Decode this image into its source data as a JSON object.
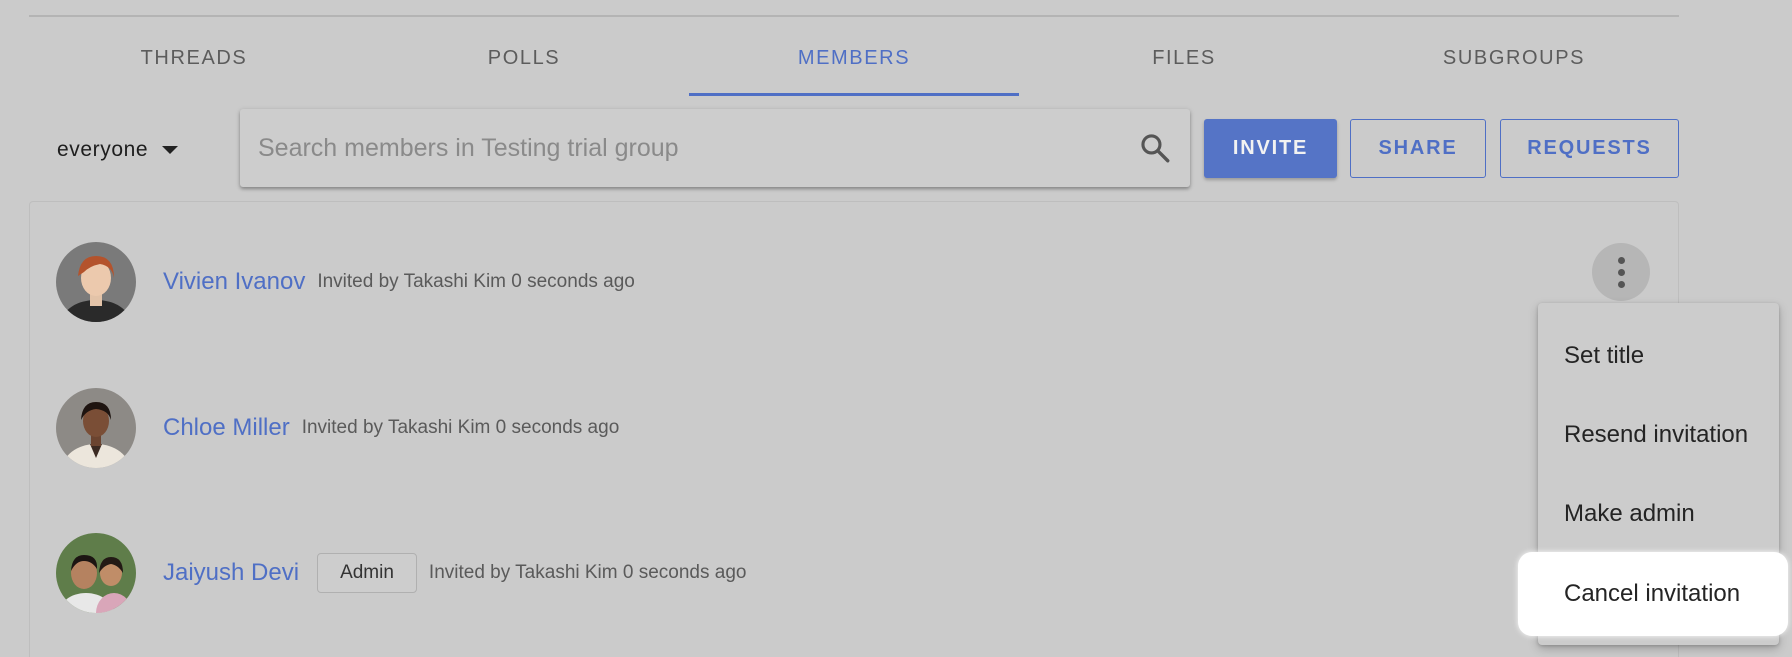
{
  "tabs": [
    "THREADS",
    "POLLS",
    "MEMBERS",
    "FILES",
    "SUBGROUPS"
  ],
  "active_tab": "MEMBERS",
  "filter": {
    "label": "everyone"
  },
  "search": {
    "placeholder": "Search members in Testing trial group",
    "value": ""
  },
  "actions": {
    "invite": "INVITE",
    "share": "SHARE",
    "requests": "REQUESTS"
  },
  "members": [
    {
      "name": "Vivien Ivanov",
      "invite_text": "Invited by Takashi Kim 0 seconds ago",
      "badge": ""
    },
    {
      "name": "Chloe Miller",
      "invite_text": "Invited by Takashi Kim 0 seconds ago",
      "badge": ""
    },
    {
      "name": "Jaiyush Devi",
      "invite_text": "Invited by Takashi Kim 0 seconds ago",
      "badge": "Admin"
    }
  ],
  "menu": {
    "items": [
      "Set title",
      "Resend invitation",
      "Make admin",
      "Cancel invitation"
    ],
    "highlighted": "Cancel invitation"
  },
  "colors": {
    "accent": "#4f6fc5",
    "background": "#cbcbcb",
    "invite_button": "#5574c6"
  }
}
